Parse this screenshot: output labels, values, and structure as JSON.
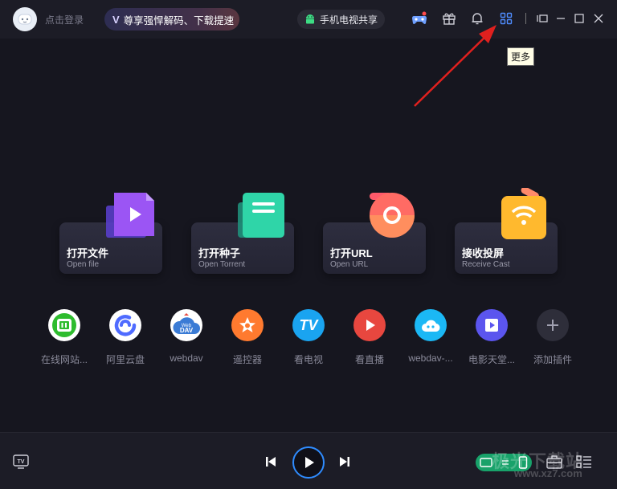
{
  "header": {
    "login_label": "点击登录",
    "vip_badge": "V",
    "vip_promo": "尊享强悍解码、下载提速",
    "share_label": "手机电视共享",
    "icons": [
      "game-icon",
      "gift-icon",
      "bell-icon",
      "more-grid-icon",
      "mini-mode-icon",
      "minimize-icon",
      "maximize-icon",
      "close-icon"
    ]
  },
  "tooltip": {
    "text": "更多"
  },
  "cards": [
    {
      "title": "打开文件",
      "subtitle": "Open file",
      "icon": "open-file-icon"
    },
    {
      "title": "打开种子",
      "subtitle": "Open Torrent",
      "icon": "open-torrent-icon"
    },
    {
      "title": "打开URL",
      "subtitle": "Open URL",
      "icon": "open-url-icon"
    },
    {
      "title": "接收投屏",
      "subtitle": "Receive Cast",
      "icon": "receive-cast-icon"
    }
  ],
  "plugins": [
    {
      "label": "在线网站...",
      "icon": "iqiyi-icon",
      "color": "#2ebc2e"
    },
    {
      "label": "阿里云盘",
      "icon": "aliyun-drive-icon",
      "color": "#4f6bff"
    },
    {
      "label": "webdav",
      "icon": "webdav-icon",
      "color": "#3a7bd5"
    },
    {
      "label": "遥控器",
      "icon": "remote-icon",
      "color": "#ff7a2f"
    },
    {
      "label": "看电视",
      "icon": "tv-icon",
      "color": "#1aa4f0"
    },
    {
      "label": "看直播",
      "icon": "live-icon",
      "color": "#e8473f"
    },
    {
      "label": "webdav-...",
      "icon": "webdav-cloud-icon",
      "color": "#1bb8f5"
    },
    {
      "label": "电影天堂...",
      "icon": "movie-heaven-icon",
      "color": "#5b55ee"
    },
    {
      "label": "添加插件",
      "icon": "add-plugin-icon",
      "color": "#2e2e3a"
    }
  ],
  "webdav_badge": {
    "top": "Web",
    "bottom": "DAV"
  },
  "tv_badge": "TV",
  "watermark": {
    "line1": "极光下载站",
    "line2": "www.xz7.com"
  }
}
